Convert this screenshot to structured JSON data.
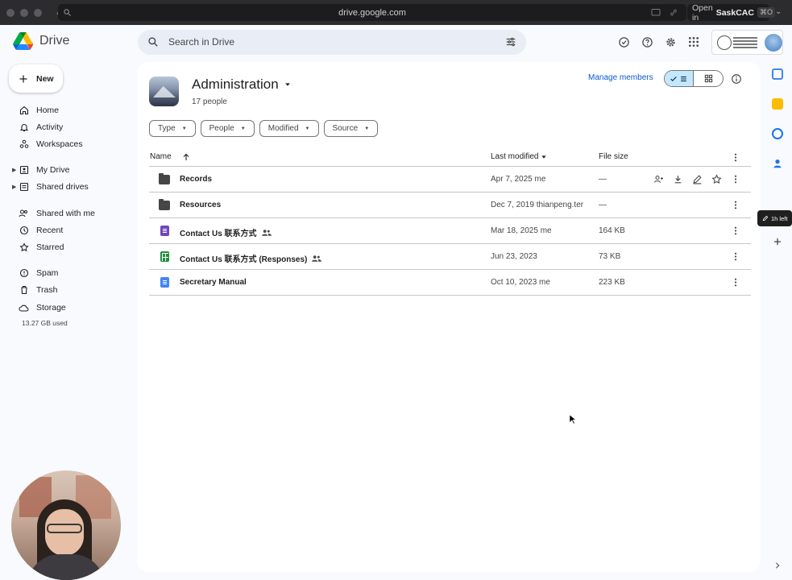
{
  "browser": {
    "url": "drive.google.com",
    "open_in_label": "Open in",
    "open_in_app": "SaskCAC",
    "open_in_shortcut": "⌘O"
  },
  "header": {
    "app_name": "Drive",
    "search_placeholder": "Search in Drive"
  },
  "sidebar": {
    "new_label": "New",
    "items": [
      {
        "label": "Home",
        "icon": "home-icon"
      },
      {
        "label": "Activity",
        "icon": "bell-icon"
      },
      {
        "label": "Workspaces",
        "icon": "workspaces-icon"
      },
      {
        "label": "My Drive",
        "icon": "my-drive-icon"
      },
      {
        "label": "Shared drives",
        "icon": "shared-drives-icon"
      },
      {
        "label": "Shared with me",
        "icon": "people-icon"
      },
      {
        "label": "Recent",
        "icon": "clock-icon"
      },
      {
        "label": "Starred",
        "icon": "star-icon"
      },
      {
        "label": "Spam",
        "icon": "spam-icon"
      },
      {
        "label": "Trash",
        "icon": "trash-icon"
      },
      {
        "label": "Storage",
        "icon": "cloud-icon"
      }
    ],
    "storage_used": "13.27 GB used"
  },
  "drive": {
    "title": "Administration",
    "subtitle": "17 people",
    "manage_members": "Manage members"
  },
  "filters": [
    "Type",
    "People",
    "Modified",
    "Source"
  ],
  "table": {
    "columns": {
      "name": "Name",
      "last_modified": "Last modified",
      "file_size": "File size"
    },
    "rows": [
      {
        "name": "Records",
        "type": "folder",
        "modified": "Apr 7, 2025 me",
        "size": "—",
        "shared": false
      },
      {
        "name": "Resources",
        "type": "folder",
        "modified": "Dec 7, 2019 thianpeng.ter",
        "size": "—",
        "shared": false
      },
      {
        "name": "Contact Us 联系方式",
        "type": "form",
        "modified": "Mar 18, 2025 me",
        "size": "164 KB",
        "shared": true
      },
      {
        "name": "Contact Us 联系方式 (Responses)",
        "type": "sheet",
        "modified": "Jun 23, 2023",
        "size": "73 KB",
        "shared": true
      },
      {
        "name": "Secretary Manual",
        "type": "doc",
        "modified": "Oct 10, 2023 me",
        "size": "223 KB",
        "shared": false
      }
    ]
  },
  "side_panel": {
    "tooltip": "1h left"
  },
  "colors": {
    "accent": "#0b57d0",
    "selected_toggle": "#c2e7ff",
    "form": "#7248b9",
    "sheet": "#1e8e3e",
    "doc": "#4285f4"
  }
}
